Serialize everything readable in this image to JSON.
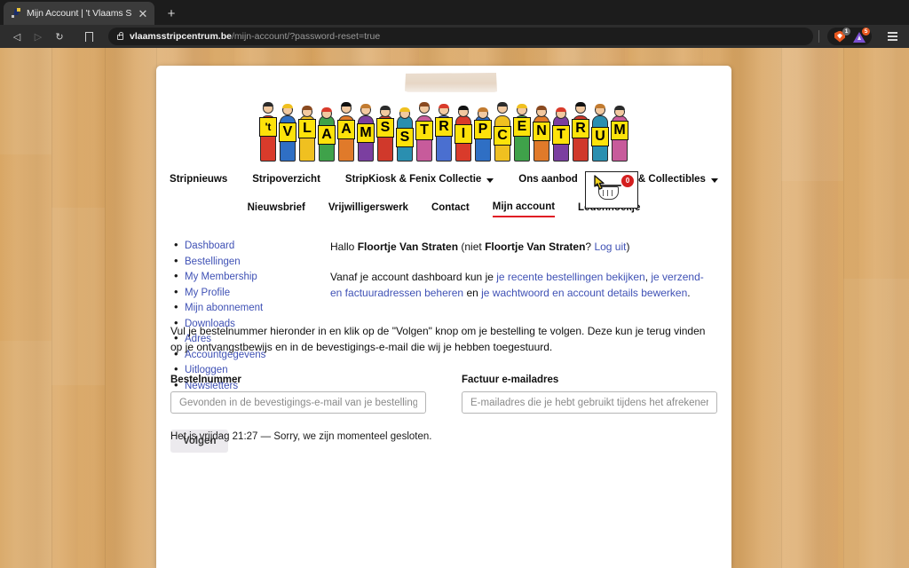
{
  "browser": {
    "tab": {
      "title": "Mijn Account | 't Vlaams Stripce",
      "favicon_name": "site-favicon",
      "close_label": "✕"
    },
    "new_tab_label": "+",
    "nav": {
      "back_label": "◁",
      "forward_label": "▷",
      "reload_label": "↻",
      "bookmark_name": "bookmark-icon"
    },
    "omnibox": {
      "domain": "vlaamsstripcentrum.be",
      "path": "/mijn-account/?password-reset=true",
      "lock_name": "lock-icon"
    },
    "extensions": [
      {
        "name": "brave-shields-icon",
        "badge": "1"
      },
      {
        "name": "extension-triangle-icon",
        "badge": "5"
      }
    ],
    "menu_label": "menu-icon"
  },
  "site": {
    "logo": {
      "alt": "'t Vlaams Stripcentrum",
      "letters": [
        "'t",
        "V",
        "L",
        "A",
        "A",
        "M",
        "S",
        "S",
        "T",
        "R",
        "I",
        "P",
        "C",
        "E",
        "N",
        "T",
        "R",
        "U",
        "M"
      ]
    },
    "nav_row1": [
      {
        "label": "Stripnieuws",
        "has_dropdown": false,
        "active": false
      },
      {
        "label": "Stripoverzicht",
        "has_dropdown": false,
        "active": false
      },
      {
        "label": "StripKiosk & Fenix Collectie",
        "has_dropdown": true,
        "active": false
      },
      {
        "label": "Ons aanbod",
        "has_dropdown": false,
        "active": false
      },
      {
        "label": "Winkel & Collectibles",
        "has_dropdown": true,
        "active": false
      }
    ],
    "nav_row2": [
      {
        "label": "Nieuwsbrief",
        "has_dropdown": false,
        "active": false
      },
      {
        "label": "Vrijwilligerswerk",
        "has_dropdown": false,
        "active": false
      },
      {
        "label": "Contact",
        "has_dropdown": false,
        "active": false
      },
      {
        "label": "Mijn account",
        "has_dropdown": false,
        "active": true
      },
      {
        "label": "Ledenhoekje",
        "has_dropdown": false,
        "active": false
      }
    ],
    "accent_color": "#e01b24",
    "link_color": "#3f51b5"
  },
  "account": {
    "sidebar": [
      "Dashboard",
      "Bestellingen",
      "My Membership",
      "My Profile",
      "Mijn abonnement",
      "Downloads",
      "Adres",
      "Accountgegevens",
      "Uitloggen",
      "Newsletters"
    ],
    "greeting": {
      "prefix": "Hallo ",
      "name": "Floortje Van Straten",
      "mid": " (niet ",
      "name2": "Floortje Van Straten",
      "qmark": "? ",
      "logout_link": "Log uit",
      "suffix": ")"
    },
    "dashboard_text": {
      "p1": "Vanaf je account dashboard kun je ",
      "link1": "je recente bestellingen bekijken",
      "p2": ", ",
      "link2": "je verzend- en factuuradressen beheren",
      "p3": " en ",
      "link3": "je wachtwoord en account details bewerken",
      "p4": "."
    }
  },
  "track_order": {
    "intro": "Vul je bestelnummer hieronder in en klik op de \"Volgen\" knop om je bestelling te volgen. Deze kun je terug vinden op je ontvangstbewijs en in de bevestigings-e-mail die wij je hebben toegestuurd.",
    "order_number": {
      "label": "Bestelnummer",
      "value": "",
      "placeholder": "Gevonden in de bevestigings-e-mail van je bestelling."
    },
    "billing_email": {
      "label": "Factuur e-mailadres",
      "value": "",
      "placeholder": "E-mailadres die je hebt gebruikt tijdens het afrekener"
    },
    "submit_label": "Volgen"
  },
  "footer_note": "Het is vrijdag 21:27 — Sorry, we zijn momenteel gesloten.",
  "cart": {
    "count": "0",
    "basket_name": "shopping-basket-icon",
    "badge_color": "#d41f1f"
  }
}
